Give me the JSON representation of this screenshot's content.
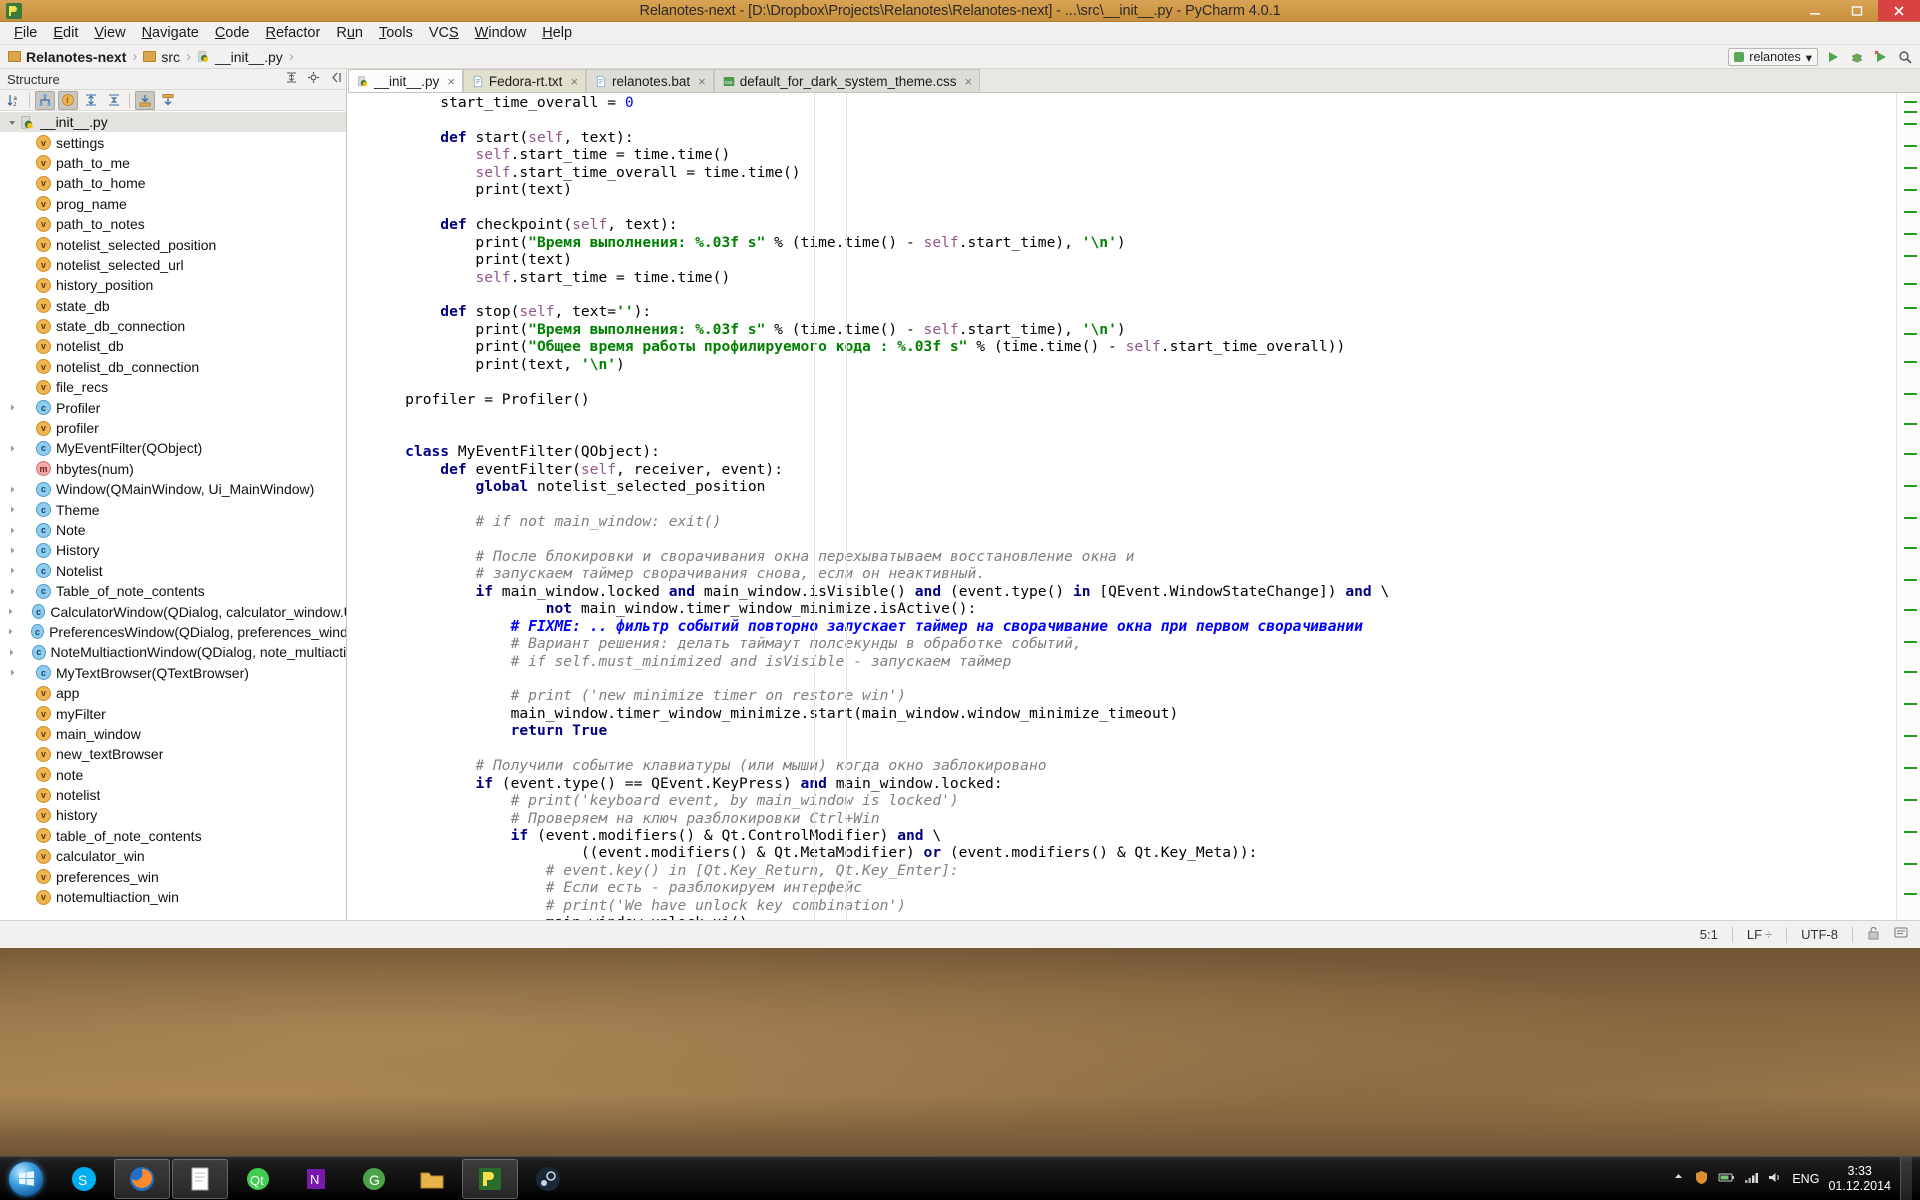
{
  "window": {
    "title": "Relanotes-next - [D:\\Dropbox\\Projects\\Relanotes\\Relanotes-next] - ...\\src\\__init__.py - PyCharm 4.0.1",
    "minimize": "minimize-button",
    "maximize": "maximize-button",
    "close": "close-button"
  },
  "menu": {
    "items": [
      {
        "label": "File",
        "mnemonic": "F"
      },
      {
        "label": "Edit",
        "mnemonic": "E"
      },
      {
        "label": "View",
        "mnemonic": "V"
      },
      {
        "label": "Navigate",
        "mnemonic": "N"
      },
      {
        "label": "Code",
        "mnemonic": "C"
      },
      {
        "label": "Refactor",
        "mnemonic": "R"
      },
      {
        "label": "Run",
        "mnemonic": "n"
      },
      {
        "label": "Tools",
        "mnemonic": "T"
      },
      {
        "label": "VCS",
        "mnemonic": "S"
      },
      {
        "label": "Window",
        "mnemonic": "W"
      },
      {
        "label": "Help",
        "mnemonic": "H"
      }
    ]
  },
  "breadcrumb": {
    "items": [
      {
        "label": "Relanotes-next",
        "icon": "folder-icon",
        "bold": true
      },
      {
        "label": "src",
        "icon": "folder-icon",
        "bold": false
      },
      {
        "label": "__init__.py",
        "icon": "python-file-icon",
        "bold": false
      }
    ],
    "separator": "›",
    "run_config": "relanotes",
    "run_config_caret": "▾",
    "buttons": [
      "run-button",
      "debug-button",
      "coverage-button",
      "search-everywhere-button"
    ]
  },
  "structure": {
    "title": "Structure",
    "header_icons": [
      "expand-collapse-icon",
      "settings-icon",
      "hide-icon"
    ],
    "toolbar_icons": [
      "sort-alphabetically-icon",
      "show-inherited-icon",
      "show-fields-icon",
      "expand-all-icon",
      "collapse-all-icon",
      "autoscroll-to-source-icon",
      "autoscroll-from-source-icon"
    ],
    "root": {
      "label": "__init__.py",
      "icon": "python-file-icon",
      "expanded": true
    },
    "items": [
      {
        "label": "settings",
        "kind": "v",
        "expandable": false
      },
      {
        "label": "path_to_me",
        "kind": "v",
        "expandable": false
      },
      {
        "label": "path_to_home",
        "kind": "v",
        "expandable": false
      },
      {
        "label": "prog_name",
        "kind": "v",
        "expandable": false
      },
      {
        "label": "path_to_notes",
        "kind": "v",
        "expandable": false
      },
      {
        "label": "notelist_selected_position",
        "kind": "v",
        "expandable": false
      },
      {
        "label": "notelist_selected_url",
        "kind": "v",
        "expandable": false
      },
      {
        "label": "history_position",
        "kind": "v",
        "expandable": false
      },
      {
        "label": "state_db",
        "kind": "v",
        "expandable": false
      },
      {
        "label": "state_db_connection",
        "kind": "v",
        "expandable": false
      },
      {
        "label": "notelist_db",
        "kind": "v",
        "expandable": false
      },
      {
        "label": "notelist_db_connection",
        "kind": "v",
        "expandable": false
      },
      {
        "label": "file_recs",
        "kind": "v",
        "expandable": false
      },
      {
        "label": "Profiler",
        "kind": "c",
        "expandable": true
      },
      {
        "label": "profiler",
        "kind": "v",
        "expandable": false
      },
      {
        "label": "MyEventFilter(QObject)",
        "kind": "c",
        "expandable": true
      },
      {
        "label": "hbytes(num)",
        "kind": "m",
        "expandable": false
      },
      {
        "label": "Window(QMainWindow, Ui_MainWindow)",
        "kind": "c",
        "expandable": true
      },
      {
        "label": "Theme",
        "kind": "c",
        "expandable": true
      },
      {
        "label": "Note",
        "kind": "c",
        "expandable": true
      },
      {
        "label": "History",
        "kind": "c",
        "expandable": true
      },
      {
        "label": "Notelist",
        "kind": "c",
        "expandable": true
      },
      {
        "label": "Table_of_note_contents",
        "kind": "c",
        "expandable": true
      },
      {
        "label": "CalculatorWindow(QDialog, calculator_window.Ui_Dial",
        "kind": "c",
        "expandable": true
      },
      {
        "label": "PreferencesWindow(QDialog, preferences_window.Ui_D",
        "kind": "c",
        "expandable": true
      },
      {
        "label": "NoteMultiactionWindow(QDialog, note_multiaction.Ui_",
        "kind": "c",
        "expandable": true
      },
      {
        "label": "MyTextBrowser(QTextBrowser)",
        "kind": "c",
        "expandable": true
      },
      {
        "label": "app",
        "kind": "v",
        "expandable": false
      },
      {
        "label": "myFilter",
        "kind": "v",
        "expandable": false
      },
      {
        "label": "main_window",
        "kind": "v",
        "expandable": false
      },
      {
        "label": "new_textBrowser",
        "kind": "v",
        "expandable": false
      },
      {
        "label": "note",
        "kind": "v",
        "expandable": false
      },
      {
        "label": "notelist",
        "kind": "v",
        "expandable": false
      },
      {
        "label": "history",
        "kind": "v",
        "expandable": false
      },
      {
        "label": "table_of_note_contents",
        "kind": "v",
        "expandable": false
      },
      {
        "label": "calculator_win",
        "kind": "v",
        "expandable": false
      },
      {
        "label": "preferences_win",
        "kind": "v",
        "expandable": false
      },
      {
        "label": "notemultiaction_win",
        "kind": "v",
        "expandable": false
      }
    ]
  },
  "editor": {
    "tabs": [
      {
        "label": "__init__.py",
        "icon": "python-file-icon",
        "state": "active",
        "close": "×"
      },
      {
        "label": "Fedora-rt.txt",
        "icon": "text-file-icon",
        "state": "modified",
        "close": "×"
      },
      {
        "label": "relanotes.bat",
        "icon": "text-file-icon",
        "state": "normal",
        "close": "×"
      },
      {
        "label": "default_for_dark_system_theme.css",
        "icon": "css-file-icon",
        "state": "normal",
        "close": "×"
      }
    ],
    "lines": [
      {
        "indent": 2,
        "tokens": [
          {
            "t": "start_time_overall = ",
            "c": ""
          },
          {
            "t": "0",
            "c": "num"
          }
        ]
      },
      {
        "indent": 0,
        "tokens": []
      },
      {
        "indent": 2,
        "tokens": [
          {
            "t": "def ",
            "c": "kw"
          },
          {
            "t": "start(",
            "c": ""
          },
          {
            "t": "self",
            "c": "self"
          },
          {
            "t": ", text):",
            "c": ""
          }
        ]
      },
      {
        "indent": 3,
        "tokens": [
          {
            "t": "self",
            "c": "self"
          },
          {
            "t": ".start_time = time.time()",
            "c": ""
          }
        ]
      },
      {
        "indent": 3,
        "tokens": [
          {
            "t": "self",
            "c": "self"
          },
          {
            "t": ".start_time_overall = time.time()",
            "c": ""
          }
        ]
      },
      {
        "indent": 3,
        "tokens": [
          {
            "t": "print(text)",
            "c": ""
          }
        ]
      },
      {
        "indent": 0,
        "tokens": []
      },
      {
        "indent": 2,
        "tokens": [
          {
            "t": "def ",
            "c": "kw"
          },
          {
            "t": "checkpoint(",
            "c": ""
          },
          {
            "t": "self",
            "c": "self"
          },
          {
            "t": ", text):",
            "c": ""
          }
        ]
      },
      {
        "indent": 3,
        "tokens": [
          {
            "t": "print(",
            "c": ""
          },
          {
            "t": "\"Время выполнения: %.03f s\"",
            "c": "str"
          },
          {
            "t": " % (time.time() - ",
            "c": ""
          },
          {
            "t": "self",
            "c": "self"
          },
          {
            "t": ".start_time), ",
            "c": ""
          },
          {
            "t": "'\\n'",
            "c": "str"
          },
          {
            "t": ")",
            "c": ""
          }
        ]
      },
      {
        "indent": 3,
        "tokens": [
          {
            "t": "print(text)",
            "c": ""
          }
        ]
      },
      {
        "indent": 3,
        "tokens": [
          {
            "t": "self",
            "c": "self"
          },
          {
            "t": ".start_time = time.time()",
            "c": ""
          }
        ]
      },
      {
        "indent": 0,
        "tokens": []
      },
      {
        "indent": 2,
        "tokens": [
          {
            "t": "def ",
            "c": "kw"
          },
          {
            "t": "stop(",
            "c": ""
          },
          {
            "t": "self",
            "c": "self"
          },
          {
            "t": ", text=",
            "c": ""
          },
          {
            "t": "''",
            "c": "str"
          },
          {
            "t": "):",
            "c": ""
          }
        ]
      },
      {
        "indent": 3,
        "tokens": [
          {
            "t": "print(",
            "c": ""
          },
          {
            "t": "\"Время выполнения: %.03f s\"",
            "c": "str"
          },
          {
            "t": " % (time.time() - ",
            "c": ""
          },
          {
            "t": "self",
            "c": "self"
          },
          {
            "t": ".start_time), ",
            "c": ""
          },
          {
            "t": "'\\n'",
            "c": "str"
          },
          {
            "t": ")",
            "c": ""
          }
        ]
      },
      {
        "indent": 3,
        "tokens": [
          {
            "t": "print(",
            "c": ""
          },
          {
            "t": "\"Общее время работы профилируемого кода : %.03f s\"",
            "c": "str"
          },
          {
            "t": " % (time.time() - ",
            "c": ""
          },
          {
            "t": "self",
            "c": "self"
          },
          {
            "t": ".start_time_overall))",
            "c": ""
          }
        ]
      },
      {
        "indent": 3,
        "tokens": [
          {
            "t": "print(text, ",
            "c": ""
          },
          {
            "t": "'\\n'",
            "c": "str"
          },
          {
            "t": ")",
            "c": ""
          }
        ]
      },
      {
        "indent": 0,
        "tokens": []
      },
      {
        "indent": 1,
        "tokens": [
          {
            "t": "profiler = Profiler()",
            "c": ""
          }
        ]
      },
      {
        "indent": 0,
        "tokens": []
      },
      {
        "indent": 0,
        "tokens": []
      },
      {
        "indent": 1,
        "tokens": [
          {
            "t": "class ",
            "c": "kw"
          },
          {
            "t": "MyEventFilter(QObject):",
            "c": ""
          }
        ]
      },
      {
        "indent": 2,
        "tokens": [
          {
            "t": "def ",
            "c": "kw"
          },
          {
            "t": "eventFilter(",
            "c": ""
          },
          {
            "t": "self",
            "c": "self"
          },
          {
            "t": ", receiver, event):",
            "c": ""
          }
        ]
      },
      {
        "indent": 3,
        "tokens": [
          {
            "t": "global ",
            "c": "kw"
          },
          {
            "t": "notelist_selected_position",
            "c": ""
          }
        ]
      },
      {
        "indent": 0,
        "tokens": []
      },
      {
        "indent": 3,
        "tokens": [
          {
            "t": "# if not main_window: exit()",
            "c": "cmt"
          }
        ]
      },
      {
        "indent": 0,
        "tokens": []
      },
      {
        "indent": 3,
        "tokens": [
          {
            "t": "# После блокировки и сворачивания окна перехыватываем восстановление окна и",
            "c": "cmt"
          }
        ]
      },
      {
        "indent": 3,
        "tokens": [
          {
            "t": "# запускаем таймер сворачивания снова, если он неактивный.",
            "c": "cmt"
          }
        ]
      },
      {
        "indent": 3,
        "tokens": [
          {
            "t": "if ",
            "c": "kw"
          },
          {
            "t": "main_window.locked ",
            "c": ""
          },
          {
            "t": "and ",
            "c": "kw"
          },
          {
            "t": "main_window.isVisible() ",
            "c": ""
          },
          {
            "t": "and ",
            "c": "kw"
          },
          {
            "t": "(event.type() ",
            "c": ""
          },
          {
            "t": "in ",
            "c": "kw"
          },
          {
            "t": "[QEvent.WindowStateChange]) ",
            "c": ""
          },
          {
            "t": "and ",
            "c": "kw"
          },
          {
            "t": "\\",
            "c": ""
          }
        ]
      },
      {
        "indent": 5,
        "tokens": [
          {
            "t": "not ",
            "c": "kw"
          },
          {
            "t": "main_window.timer_window_minimize.isActive():",
            "c": ""
          }
        ]
      },
      {
        "indent": 4,
        "tokens": [
          {
            "t": "# FIXME: ",
            "c": "cmt-todo"
          },
          {
            "t": ".. фильтр событий повторно запускает таймер на сворачивание окна при первом сворачивании",
            "c": "cmt-todo"
          }
        ]
      },
      {
        "indent": 4,
        "tokens": [
          {
            "t": "# Вариант решения: делать таймаут полсекунды в обработке событий,",
            "c": "cmt"
          }
        ]
      },
      {
        "indent": 4,
        "tokens": [
          {
            "t": "# if self.must_minimized and isVisible - запускаем таймер",
            "c": "cmt"
          }
        ]
      },
      {
        "indent": 0,
        "tokens": []
      },
      {
        "indent": 4,
        "tokens": [
          {
            "t": "# print ('new minimize timer on restore win')",
            "c": "cmt"
          }
        ]
      },
      {
        "indent": 4,
        "tokens": [
          {
            "t": "main_window.timer_window_minimize.start(main_window.window_minimize_timeout)",
            "c": ""
          }
        ]
      },
      {
        "indent": 4,
        "tokens": [
          {
            "t": "return ",
            "c": "kw"
          },
          {
            "t": "True",
            "c": "kw"
          }
        ]
      },
      {
        "indent": 0,
        "tokens": []
      },
      {
        "indent": 3,
        "tokens": [
          {
            "t": "# Получили событие клавиатуры (или мыши) когда окно заблокировано",
            "c": "cmt"
          }
        ]
      },
      {
        "indent": 3,
        "tokens": [
          {
            "t": "if ",
            "c": "kw"
          },
          {
            "t": "(event.type() == QEvent.KeyPress) ",
            "c": ""
          },
          {
            "t": "and ",
            "c": "kw"
          },
          {
            "t": "main_window.locked:",
            "c": ""
          }
        ]
      },
      {
        "indent": 4,
        "tokens": [
          {
            "t": "# print('keyboard event, by main_window is locked')",
            "c": "cmt"
          }
        ]
      },
      {
        "indent": 4,
        "tokens": [
          {
            "t": "# Проверяем на ключ разблокировки Ctrl+Win",
            "c": "cmt"
          }
        ]
      },
      {
        "indent": 4,
        "tokens": [
          {
            "t": "if ",
            "c": "kw"
          },
          {
            "t": "(event.modifiers() & Qt.ControlModifier) ",
            "c": ""
          },
          {
            "t": "and ",
            "c": "kw"
          },
          {
            "t": "\\",
            "c": ""
          }
        ]
      },
      {
        "indent": 6,
        "tokens": [
          {
            "t": "((event.modifiers() & Qt.MetaModifier) ",
            "c": ""
          },
          {
            "t": "or ",
            "c": "kw"
          },
          {
            "t": "(event.modifiers() & Qt.Key_Meta)):",
            "c": ""
          }
        ]
      },
      {
        "indent": 5,
        "tokens": [
          {
            "t": "# event.key() in [Qt.Key_Return, Qt.Key_Enter]:",
            "c": "cmt"
          }
        ]
      },
      {
        "indent": 5,
        "tokens": [
          {
            "t": "# Если есть - разблокируем интерфейс",
            "c": "cmt"
          }
        ]
      },
      {
        "indent": 5,
        "tokens": [
          {
            "t": "# print('We have unlock key combination')",
            "c": "cmt"
          }
        ]
      },
      {
        "indent": 5,
        "tokens": [
          {
            "t": "main_window.unlock_ui()",
            "c": ""
          }
        ]
      }
    ]
  },
  "statusbar": {
    "caret": "5:1",
    "line_separator": "LF",
    "line_separator_caret": "÷",
    "encoding": "UTF-8",
    "lock_icon": "unlocked-icon",
    "event_icon": "event-log-icon"
  },
  "taskbar": {
    "start": "start-orb",
    "items": [
      {
        "name": "skype-taskbar-icon",
        "active": false
      },
      {
        "name": "firefox-taskbar-icon",
        "active": true
      },
      {
        "name": "notepad-taskbar-icon",
        "active": true
      },
      {
        "name": "qt-taskbar-icon",
        "active": false
      },
      {
        "name": "onenote-taskbar-icon",
        "active": false
      },
      {
        "name": "sublime-taskbar-icon",
        "active": false
      },
      {
        "name": "explorer-taskbar-icon",
        "active": false
      },
      {
        "name": "pycharm-taskbar-icon",
        "active": true
      },
      {
        "name": "steam-taskbar-icon",
        "active": false
      }
    ],
    "tray_icons": [
      "show-hidden-icons",
      "network-icon",
      "volume-icon",
      "battery-icon",
      "antivirus-icon"
    ],
    "language": "ENG",
    "clock_time": "3:33",
    "clock_date": "01.12.2014",
    "show_desktop": "show-desktop-button"
  },
  "colors": {
    "titlebar": "#cf9846",
    "close_button": "#d84242",
    "accent_tab_modified": "#e1e0cc",
    "keyword": "#000080",
    "string": "#008000",
    "comment": "#808080",
    "todo": "#0000ff",
    "self": "#94558d",
    "number": "#0000ff"
  }
}
